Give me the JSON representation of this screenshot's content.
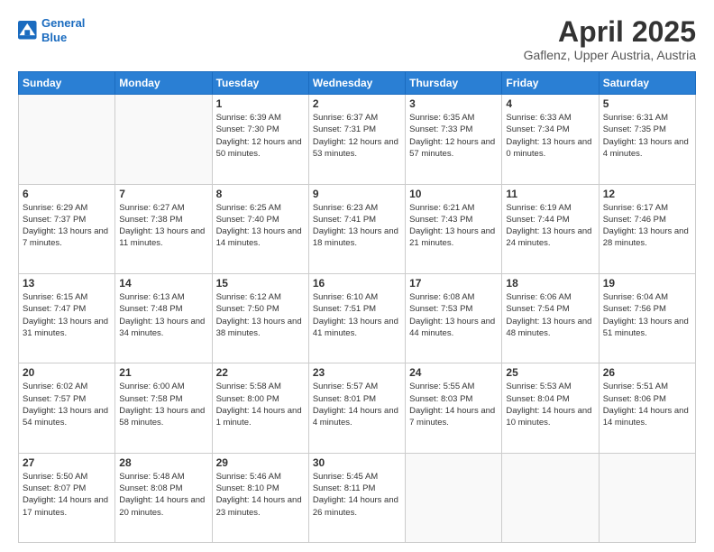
{
  "header": {
    "logo_line1": "General",
    "logo_line2": "Blue",
    "month": "April 2025",
    "location": "Gaflenz, Upper Austria, Austria"
  },
  "days_of_week": [
    "Sunday",
    "Monday",
    "Tuesday",
    "Wednesday",
    "Thursday",
    "Friday",
    "Saturday"
  ],
  "weeks": [
    [
      {
        "day": "",
        "info": ""
      },
      {
        "day": "",
        "info": ""
      },
      {
        "day": "1",
        "info": "Sunrise: 6:39 AM\nSunset: 7:30 PM\nDaylight: 12 hours\nand 50 minutes."
      },
      {
        "day": "2",
        "info": "Sunrise: 6:37 AM\nSunset: 7:31 PM\nDaylight: 12 hours\nand 53 minutes."
      },
      {
        "day": "3",
        "info": "Sunrise: 6:35 AM\nSunset: 7:33 PM\nDaylight: 12 hours\nand 57 minutes."
      },
      {
        "day": "4",
        "info": "Sunrise: 6:33 AM\nSunset: 7:34 PM\nDaylight: 13 hours\nand 0 minutes."
      },
      {
        "day": "5",
        "info": "Sunrise: 6:31 AM\nSunset: 7:35 PM\nDaylight: 13 hours\nand 4 minutes."
      }
    ],
    [
      {
        "day": "6",
        "info": "Sunrise: 6:29 AM\nSunset: 7:37 PM\nDaylight: 13 hours\nand 7 minutes."
      },
      {
        "day": "7",
        "info": "Sunrise: 6:27 AM\nSunset: 7:38 PM\nDaylight: 13 hours\nand 11 minutes."
      },
      {
        "day": "8",
        "info": "Sunrise: 6:25 AM\nSunset: 7:40 PM\nDaylight: 13 hours\nand 14 minutes."
      },
      {
        "day": "9",
        "info": "Sunrise: 6:23 AM\nSunset: 7:41 PM\nDaylight: 13 hours\nand 18 minutes."
      },
      {
        "day": "10",
        "info": "Sunrise: 6:21 AM\nSunset: 7:43 PM\nDaylight: 13 hours\nand 21 minutes."
      },
      {
        "day": "11",
        "info": "Sunrise: 6:19 AM\nSunset: 7:44 PM\nDaylight: 13 hours\nand 24 minutes."
      },
      {
        "day": "12",
        "info": "Sunrise: 6:17 AM\nSunset: 7:46 PM\nDaylight: 13 hours\nand 28 minutes."
      }
    ],
    [
      {
        "day": "13",
        "info": "Sunrise: 6:15 AM\nSunset: 7:47 PM\nDaylight: 13 hours\nand 31 minutes."
      },
      {
        "day": "14",
        "info": "Sunrise: 6:13 AM\nSunset: 7:48 PM\nDaylight: 13 hours\nand 34 minutes."
      },
      {
        "day": "15",
        "info": "Sunrise: 6:12 AM\nSunset: 7:50 PM\nDaylight: 13 hours\nand 38 minutes."
      },
      {
        "day": "16",
        "info": "Sunrise: 6:10 AM\nSunset: 7:51 PM\nDaylight: 13 hours\nand 41 minutes."
      },
      {
        "day": "17",
        "info": "Sunrise: 6:08 AM\nSunset: 7:53 PM\nDaylight: 13 hours\nand 44 minutes."
      },
      {
        "day": "18",
        "info": "Sunrise: 6:06 AM\nSunset: 7:54 PM\nDaylight: 13 hours\nand 48 minutes."
      },
      {
        "day": "19",
        "info": "Sunrise: 6:04 AM\nSunset: 7:56 PM\nDaylight: 13 hours\nand 51 minutes."
      }
    ],
    [
      {
        "day": "20",
        "info": "Sunrise: 6:02 AM\nSunset: 7:57 PM\nDaylight: 13 hours\nand 54 minutes."
      },
      {
        "day": "21",
        "info": "Sunrise: 6:00 AM\nSunset: 7:58 PM\nDaylight: 13 hours\nand 58 minutes."
      },
      {
        "day": "22",
        "info": "Sunrise: 5:58 AM\nSunset: 8:00 PM\nDaylight: 14 hours\nand 1 minute."
      },
      {
        "day": "23",
        "info": "Sunrise: 5:57 AM\nSunset: 8:01 PM\nDaylight: 14 hours\nand 4 minutes."
      },
      {
        "day": "24",
        "info": "Sunrise: 5:55 AM\nSunset: 8:03 PM\nDaylight: 14 hours\nand 7 minutes."
      },
      {
        "day": "25",
        "info": "Sunrise: 5:53 AM\nSunset: 8:04 PM\nDaylight: 14 hours\nand 10 minutes."
      },
      {
        "day": "26",
        "info": "Sunrise: 5:51 AM\nSunset: 8:06 PM\nDaylight: 14 hours\nand 14 minutes."
      }
    ],
    [
      {
        "day": "27",
        "info": "Sunrise: 5:50 AM\nSunset: 8:07 PM\nDaylight: 14 hours\nand 17 minutes."
      },
      {
        "day": "28",
        "info": "Sunrise: 5:48 AM\nSunset: 8:08 PM\nDaylight: 14 hours\nand 20 minutes."
      },
      {
        "day": "29",
        "info": "Sunrise: 5:46 AM\nSunset: 8:10 PM\nDaylight: 14 hours\nand 23 minutes."
      },
      {
        "day": "30",
        "info": "Sunrise: 5:45 AM\nSunset: 8:11 PM\nDaylight: 14 hours\nand 26 minutes."
      },
      {
        "day": "",
        "info": ""
      },
      {
        "day": "",
        "info": ""
      },
      {
        "day": "",
        "info": ""
      }
    ]
  ]
}
